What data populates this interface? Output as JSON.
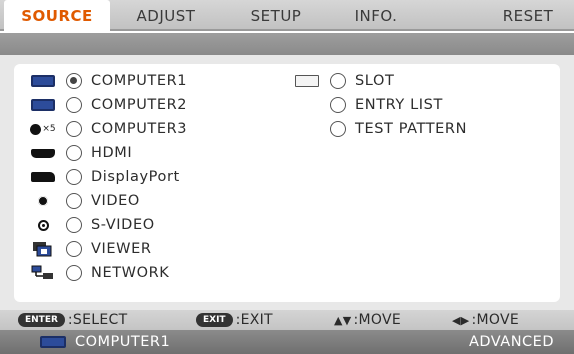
{
  "tabs": [
    {
      "label": "SOURCE",
      "active": true
    },
    {
      "label": "ADJUST",
      "active": false
    },
    {
      "label": "SETUP",
      "active": false
    },
    {
      "label": "INFO.",
      "active": false
    },
    {
      "label": "RESET",
      "active": false
    }
  ],
  "sources_left": [
    {
      "label": "COMPUTER1",
      "icon": "vga-icon",
      "selected": true
    },
    {
      "label": "COMPUTER2",
      "icon": "vga-icon",
      "selected": false
    },
    {
      "label": "COMPUTER3",
      "icon": "bnc-x5-icon",
      "icon_text": "×5",
      "selected": false
    },
    {
      "label": "HDMI",
      "icon": "hdmi-icon",
      "selected": false
    },
    {
      "label": "DisplayPort",
      "icon": "displayport-icon",
      "selected": false
    },
    {
      "label": "VIDEO",
      "icon": "video-icon",
      "selected": false
    },
    {
      "label": "S-VIDEO",
      "icon": "s-video-icon",
      "selected": false
    },
    {
      "label": "VIEWER",
      "icon": "viewer-icon",
      "selected": false
    },
    {
      "label": "NETWORK",
      "icon": "network-icon",
      "selected": false
    }
  ],
  "sources_right": [
    {
      "label": "SLOT",
      "icon": "slot-icon",
      "selected": false
    },
    {
      "label": "ENTRY LIST",
      "icon": "",
      "selected": false
    },
    {
      "label": "TEST PATTERN",
      "icon": "",
      "selected": false
    }
  ],
  "footer": {
    "enter_key": "ENTER",
    "enter_text": ":SELECT",
    "exit_key": "EXIT",
    "exit_text": ":EXIT",
    "move_v_text": ":MOVE",
    "move_h_text": ":MOVE"
  },
  "status": {
    "source": "COMPUTER1",
    "mode": "ADVANCED"
  },
  "colors": {
    "active_tab": "#e05a00",
    "panel": "#e8e8e8"
  }
}
